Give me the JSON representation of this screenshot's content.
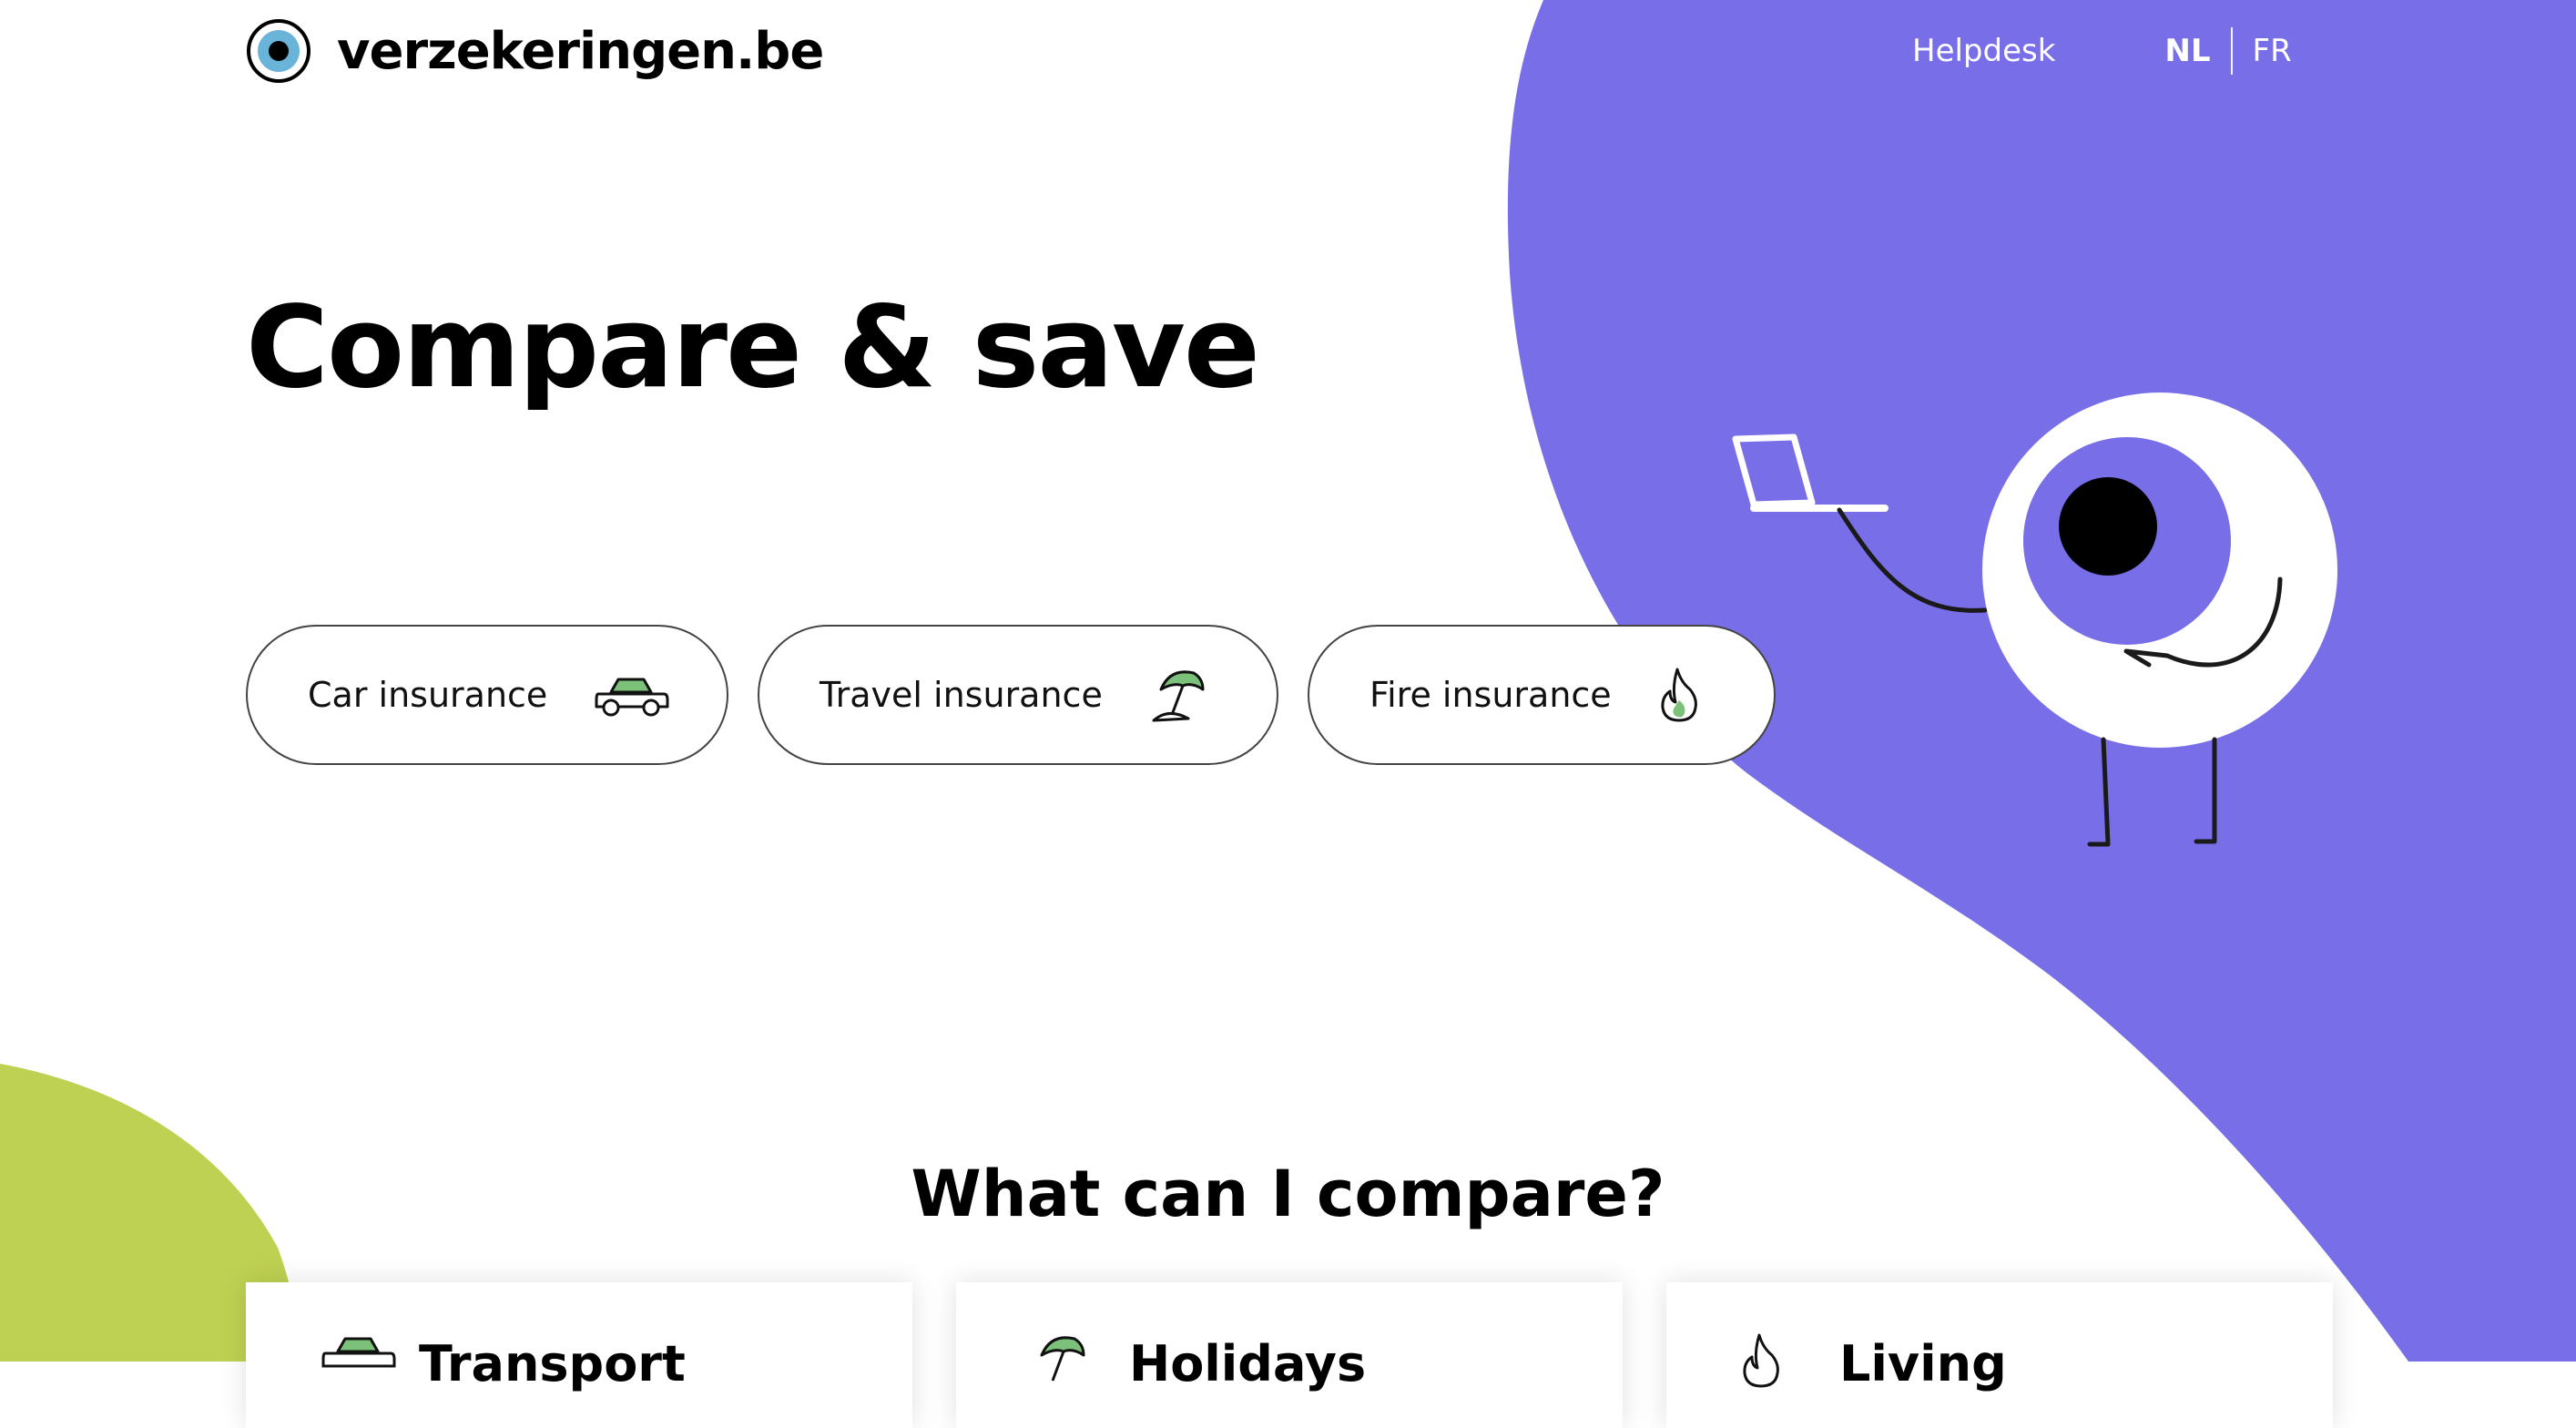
{
  "header": {
    "brand": "verzekeringen.be",
    "nav": {
      "helpdesk": "Helpdesk",
      "languages": [
        {
          "code": "NL",
          "active": true
        },
        {
          "code": "FR",
          "active": false
        }
      ]
    }
  },
  "hero": {
    "title": "Compare & save",
    "pills": [
      {
        "label": "Car insurance",
        "icon": "car-icon"
      },
      {
        "label": "Travel insurance",
        "icon": "beach-umbrella-icon"
      },
      {
        "label": "Fire insurance",
        "icon": "flame-icon"
      }
    ]
  },
  "section": {
    "title": "What can I compare?",
    "cards": [
      {
        "title": "Transport",
        "icon": "car-icon"
      },
      {
        "title": "Holidays",
        "icon": "beach-umbrella-icon"
      },
      {
        "title": "Living",
        "icon": "flame-icon"
      }
    ]
  },
  "colors": {
    "purple": "#786EE8",
    "lime": "#BFD152",
    "green": "#7CC17A",
    "logo_blue": "#6AB3D9"
  }
}
